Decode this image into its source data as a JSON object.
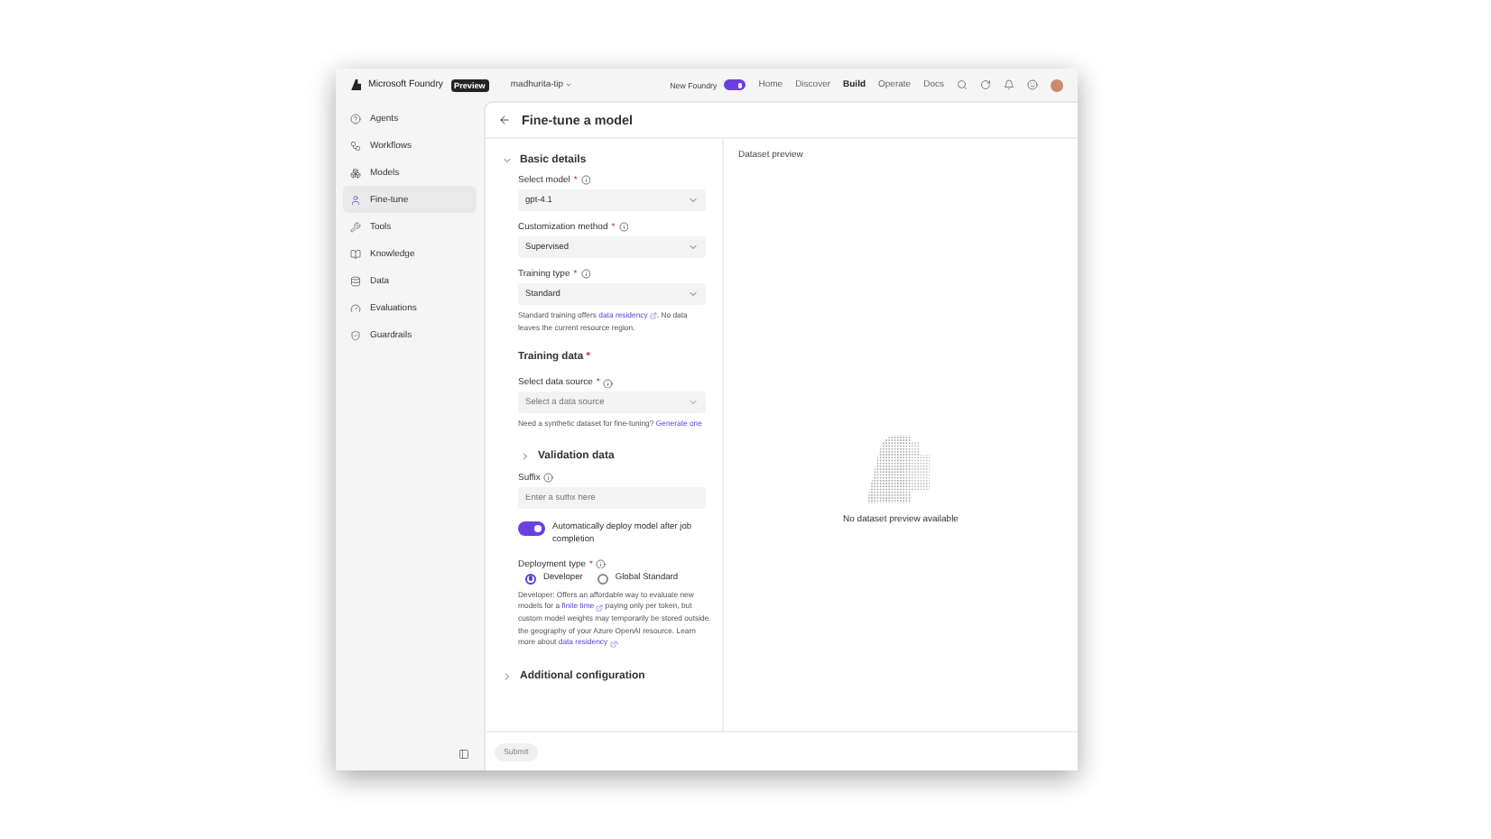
{
  "top_bar": {
    "brand": "Microsoft Foundry",
    "badge": "Preview",
    "project": "madhurita-tip",
    "toggle": {
      "label": "New Foundry",
      "on": true
    },
    "nav": [
      {
        "label": "Home",
        "selected": false
      },
      {
        "label": "Discover",
        "selected": false
      },
      {
        "label": "Build",
        "selected": true
      },
      {
        "label": "Operate",
        "selected": false
      },
      {
        "label": "Docs",
        "selected": false
      }
    ]
  },
  "sidebar": {
    "items": [
      {
        "label": "Agents",
        "selected": false
      },
      {
        "label": "Workflows",
        "selected": false
      },
      {
        "label": "Models",
        "selected": false
      },
      {
        "label": "Fine-tune",
        "selected": true
      },
      {
        "label": "Tools",
        "selected": false
      },
      {
        "label": "Knowledge",
        "selected": false
      },
      {
        "label": "Data",
        "selected": false
      },
      {
        "label": "Evaluations",
        "selected": false
      },
      {
        "label": "Guardrails",
        "selected": false
      }
    ]
  },
  "page": {
    "title": "Fine-tune a model"
  },
  "form": {
    "items": [
      {
        "kind": "section",
        "title": "Basic details",
        "expanded": true
      },
      {
        "kind": "select",
        "label": "Select model",
        "required": "*",
        "info": true,
        "value": "gpt-4.1"
      },
      {
        "kind": "select",
        "label": "Customization method",
        "required": "*",
        "info": true,
        "value": "Supervised"
      },
      {
        "kind": "select",
        "label": "Training type",
        "required": "*",
        "info": true,
        "value": "Standard"
      },
      {
        "kind": "note",
        "parts": [
          {
            "text": "Standard training offers "
          },
          {
            "link": "data residency",
            "external": true
          },
          {
            "text": ". No data leaves the current resource region."
          }
        ]
      },
      {
        "kind": "heading",
        "title": "Training data",
        "required": "*"
      },
      {
        "kind": "select",
        "label": "Select data source",
        "required": "*",
        "info": true,
        "placeholder": "Select a data source"
      },
      {
        "kind": "note",
        "parts": [
          {
            "text": "Need a synthetic dataset for fine-tuning? "
          },
          {
            "link": "Generate one",
            "external": false
          }
        ]
      },
      {
        "kind": "subsection",
        "title": "Validation data",
        "expanded": false
      },
      {
        "kind": "input",
        "label": "Suffix",
        "info": true,
        "placeholder": "Enter a suffix here"
      },
      {
        "kind": "toggle",
        "label": "Automatically deploy model after job completion",
        "on": true
      },
      {
        "kind": "radio",
        "label": "Deployment type",
        "required": "*",
        "info": true,
        "options": [
          {
            "label": "Developer",
            "selected": true
          },
          {
            "label": "Global Standard",
            "selected": false
          }
        ]
      },
      {
        "kind": "note",
        "parts": [
          {
            "text": "Developer: Offers an affordable way to evaluate new models for a "
          },
          {
            "link": "finite time",
            "external": true
          },
          {
            "text": " paying only per token, but custom model weights may temporarily be stored outside the geography of your Azure OpenAI resource. Learn more about "
          },
          {
            "link": "data residency",
            "external": true
          },
          {
            "text": "."
          }
        ]
      },
      {
        "kind": "section",
        "title": "Additional configuration",
        "expanded": false
      }
    ]
  },
  "preview": {
    "title": "Dataset preview",
    "empty_text": "No dataset preview available"
  },
  "footer": {
    "submit": {
      "label": "Submit",
      "disabled": true
    }
  }
}
